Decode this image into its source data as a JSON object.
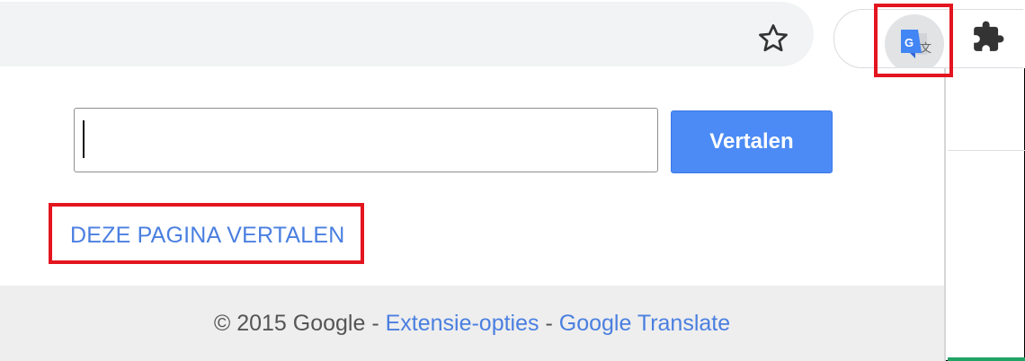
{
  "toolbar": {
    "icons": {
      "bookmark": "star-outline-icon",
      "translate_extension": "google-translate-icon",
      "extensions": "puzzle-piece-icon"
    },
    "translate_icon_letter": "G"
  },
  "popup": {
    "input": {
      "value": "",
      "placeholder": ""
    },
    "translate_button_label": "Vertalen",
    "page_translate_link": "DEZE PAGINA VERTALEN",
    "footer": {
      "copyright": "© 2015 Google",
      "separator": " - ",
      "options_link": "Extensie-opties",
      "translate_link": "Google Translate"
    }
  },
  "colors": {
    "highlight": "#e3151f",
    "button_blue": "#4c8bf5",
    "link_blue": "#4a7fe0",
    "footer_bg": "#eeeeee"
  }
}
